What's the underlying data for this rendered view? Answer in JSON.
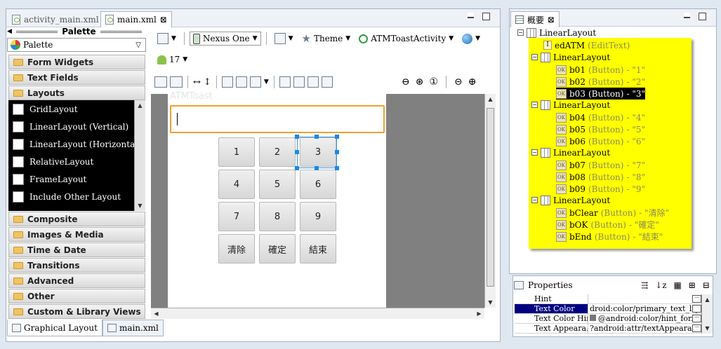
{
  "editor": {
    "tabs": [
      {
        "label": "activity_main.xml"
      },
      {
        "label": "main.xml"
      }
    ],
    "close_glyph": "⊠"
  },
  "palette": {
    "title": "Palette",
    "dropdown_label": "Palette",
    "categories": {
      "form_widgets": "Form Widgets",
      "text_fields": "Text Fields",
      "layouts": "Layouts",
      "composite": "Composite",
      "images_media": "Images & Media",
      "time_date": "Time & Date",
      "transitions": "Transitions",
      "advanced": "Advanced",
      "other": "Other",
      "custom_library": "Custom & Library Views"
    },
    "layout_items": [
      "GridLayout",
      "LinearLayout (Vertical)",
      "LinearLayout (Horizontal)",
      "RelativeLayout",
      "FrameLayout",
      "Include Other Layout"
    ]
  },
  "bottom_tabs": {
    "graphical": "Graphical Layout",
    "xml": "main.xml"
  },
  "toolbar": {
    "device": "Nexus One",
    "theme": "Theme",
    "activity": "ATMToastActivity",
    "api": "17"
  },
  "device": {
    "app_title": "ATMToast",
    "keys": [
      "1",
      "2",
      "3",
      "4",
      "5",
      "6",
      "7",
      "8",
      "9",
      "清除",
      "確定",
      "結束"
    ]
  },
  "outline": {
    "tab_label": "概要",
    "root": "LinearLayout",
    "edit": {
      "id": "edATM",
      "type": "(EditText)"
    },
    "groups": [
      {
        "label": "LinearLayout",
        "items": [
          {
            "id": "b01",
            "type": "(Button)",
            "text": "- \"1\""
          },
          {
            "id": "b02",
            "type": "(Button)",
            "text": "- \"2\""
          },
          {
            "id": "b03",
            "type": "(Button)",
            "text": "- \"3\""
          }
        ]
      },
      {
        "label": "LinearLayout",
        "items": [
          {
            "id": "b04",
            "type": "(Button)",
            "text": "- \"4\""
          },
          {
            "id": "b05",
            "type": "(Button)",
            "text": "- \"5\""
          },
          {
            "id": "b06",
            "type": "(Button)",
            "text": "- \"6\""
          }
        ]
      },
      {
        "label": "LinearLayout",
        "items": [
          {
            "id": "b07",
            "type": "(Button)",
            "text": "- \"7\""
          },
          {
            "id": "b08",
            "type": "(Button)",
            "text": "- \"8\""
          },
          {
            "id": "b09",
            "type": "(Button)",
            "text": "- \"9\""
          }
        ]
      },
      {
        "label": "LinearLayout",
        "items": [
          {
            "id": "bClear",
            "type": "(Button)",
            "text": "- \"清除\""
          },
          {
            "id": "bOK",
            "type": "(Button)",
            "text": "- \"確定\""
          },
          {
            "id": "bEnd",
            "type": "(Button)",
            "text": "- \"結束\""
          }
        ]
      }
    ]
  },
  "properties": {
    "title": "Properties",
    "rows": [
      {
        "name": "Hint",
        "value": ""
      },
      {
        "name": "Text Color",
        "value": "droid:color/primary_text_light"
      },
      {
        "name": "Text Color Hint",
        "value": "@android:color/hint_for..."
      },
      {
        "name": "Text Appeara...",
        "value": "?android:attr/textAppearanc..."
      }
    ]
  },
  "colors": {
    "outline_highlight": "#ffff00",
    "edit_focus": "#f0a030",
    "selection": "#1e88e5",
    "selected_row": "#000080"
  }
}
